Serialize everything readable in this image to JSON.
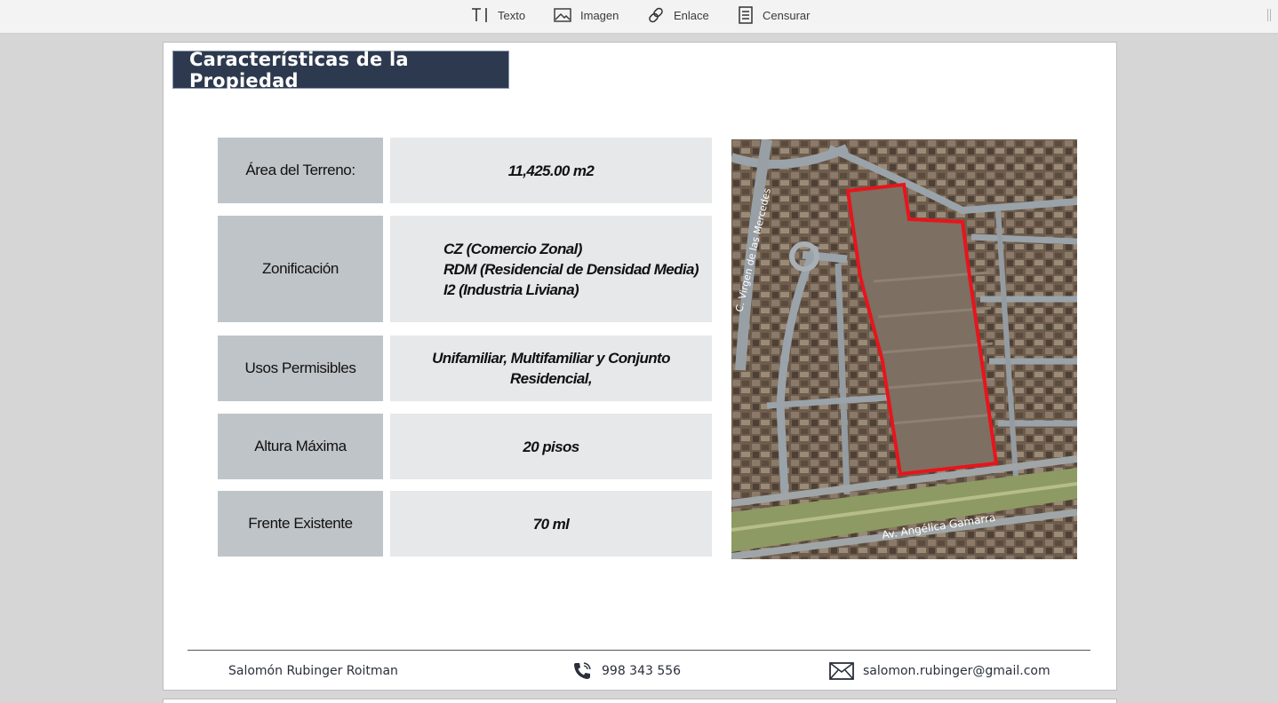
{
  "toolbar": {
    "text_label": "Texto",
    "image_label": "Imagen",
    "link_label": "Enlace",
    "redact_label": "Censurar"
  },
  "slide": {
    "title": "Características de la Propiedad",
    "rows": [
      {
        "label": "Área del Terreno:",
        "value": "11,425.00 m2"
      },
      {
        "label": "Zonificación",
        "value_lines": [
          "CZ (Comercio Zonal)",
          "RDM (Residencial de Densidad Media)",
          "I2 (Industria Liviana)"
        ]
      },
      {
        "label": "Usos Permisibles",
        "value": "Unifamiliar, Multifamiliar y Conjunto Residencial,"
      },
      {
        "label": "Altura Máxima",
        "value": "20 pisos"
      },
      {
        "label": "Frente Existente",
        "value": "70 ml"
      }
    ],
    "map": {
      "street_1": "C. Virgen de las Mercedes",
      "street_2": "Av. Angélica Gamarra",
      "outline_color": "#e8141c"
    },
    "footer": {
      "name": "Salomón Rubinger Roitman",
      "phone": "998 343 556",
      "email": "salomon.rubinger@gmail.com"
    }
  },
  "colors": {
    "title_bg": "#2d394e",
    "label_bg": "#bfc4c8",
    "value_bg": "#e7e8e9"
  }
}
